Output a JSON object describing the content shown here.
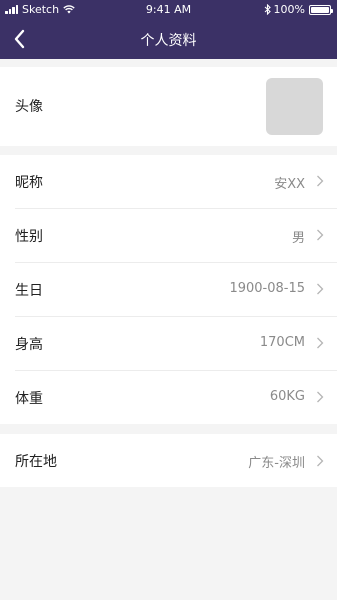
{
  "status_bar": {
    "carrier": "Sketch",
    "time": "9:41 AM",
    "battery": "100%",
    "battery_level": 1.0
  },
  "nav": {
    "title": "个人资料",
    "back_icon": "chevron-left-icon"
  },
  "avatar_row": {
    "label": "头像"
  },
  "profile_rows": [
    {
      "label": "昵称",
      "value": "安XX"
    },
    {
      "label": "性别",
      "value": "男"
    },
    {
      "label": "生日",
      "value": "1900-08-15"
    },
    {
      "label": "身高",
      "value": "170CM"
    },
    {
      "label": "体重",
      "value": "60KG"
    }
  ],
  "location_row": {
    "label": "所在地",
    "value": "广东-深圳"
  },
  "colors": {
    "header": "#3b3166",
    "background": "#f4f4f4",
    "card": "#ffffff",
    "avatar_placeholder": "#d8d8d8",
    "value_text": "#8a8a8a"
  }
}
